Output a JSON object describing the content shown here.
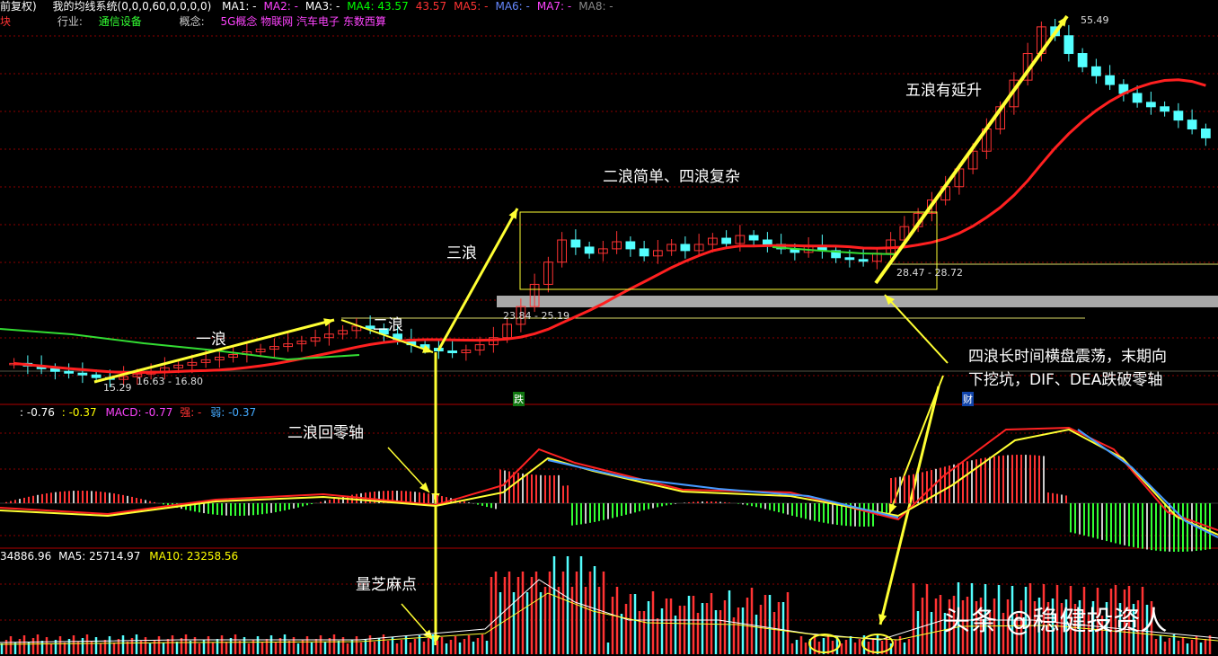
{
  "header": {
    "adjust_label": "前复权)",
    "system_label": "我的均线系统(0,0,0,60,0,0,0,0)",
    "ma_items": [
      {
        "label": "MA1:",
        "value": "-",
        "color": "#ffffff"
      },
      {
        "label": "MA2:",
        "value": "-",
        "color": "#ff44ff"
      },
      {
        "label": "MA3:",
        "value": "-",
        "color": "#ffffff"
      },
      {
        "label": "MA4:",
        "value": "43.57",
        "color": "#00ff00"
      },
      {
        "label": "",
        "value": "43.57",
        "color": "#ff3333"
      },
      {
        "label": "MA5:",
        "value": "-",
        "color": "#ff3333"
      },
      {
        "label": "MA6:",
        "value": "-",
        "color": "#6688ff"
      },
      {
        "label": "MA7:",
        "value": "-",
        "color": "#ff44ff"
      },
      {
        "label": "MA8:",
        "value": "-",
        "color": "#888888"
      }
    ],
    "block_label": "块",
    "industry_label": "行业:",
    "industry_value": "通信设备",
    "concept_label": "概念:",
    "concept_value": "5G概念 物联网 汽车电子 东数西算"
  },
  "macd_header": {
    "dif": ": -0.76",
    "dea": ": -0.37",
    "macd": "MACD: -0.77",
    "strong": "强: -",
    "weak": "弱: -0.37"
  },
  "vol_header": {
    "vol": "34886.96",
    "ma5": "MA5: 25714.97",
    "ma10": "MA10: 23258.56"
  },
  "price_labels": {
    "low": "15.29",
    "range1": "16.63 - 16.80",
    "range2": "23.84 - 25.19",
    "range3": "28.47 - 28.72",
    "high": "55.49"
  },
  "markers": {
    "die": "跌",
    "cai": "财"
  },
  "annotations": {
    "wave1": "一浪",
    "wave2": "二浪",
    "wave3": "三浪",
    "wave24": "二浪简单、四浪复杂",
    "wave5": "五浪有延升",
    "wave4_desc_line1": "四浪长时间横盘震荡，末期向",
    "wave4_desc_line2": "下挖坑，DIF、DEA跌破零轴",
    "wave2_zero": "二浪回零轴",
    "vol_dots": "量芝麻点"
  },
  "watermark": "头条 @稳健投资人",
  "colors": {
    "up": "#ff3333",
    "down": "#54ffff",
    "ma60": "#ff2020",
    "ma_green": "#33dd33",
    "annotation": "#ffff33",
    "grid": "#8b0000"
  },
  "chart_data": [
    {
      "type": "candlestick",
      "panel": "price",
      "series": [
        {
          "name": "MA4",
          "description": "60-day moving average"
        }
      ],
      "key_points": [
        {
          "label": "15.29",
          "kind": "low"
        },
        {
          "label": "16.63 - 16.80",
          "kind": "range"
        },
        {
          "label": "23.84 - 25.19",
          "kind": "range"
        },
        {
          "label": "28.47 - 28.72",
          "kind": "range"
        },
        {
          "label": "55.49",
          "kind": "high"
        }
      ],
      "approx_closes": [
        17.1,
        16.8,
        16.5,
        16.2,
        16.0,
        15.8,
        15.5,
        15.3,
        15.6,
        15.9,
        16.2,
        16.6,
        16.9,
        17.2,
        17.5,
        17.8,
        18.1,
        18.4,
        18.7,
        19.0,
        19.3,
        19.6,
        20.0,
        20.4,
        20.8,
        21.3,
        21.0,
        20.4,
        19.8,
        19.2,
        18.8,
        18.5,
        18.3,
        18.6,
        19.2,
        20.0,
        21.5,
        23.5,
        26.0,
        28.5,
        31.0,
        30.2,
        29.5,
        30.0,
        30.8,
        30.0,
        29.2,
        29.8,
        30.5,
        29.8,
        30.5,
        31.2,
        30.6,
        31.5,
        31.0,
        30.5,
        30.0,
        29.6,
        30.4,
        29.8,
        29.0,
        28.8,
        28.6,
        29.5,
        31.0,
        32.5,
        34.0,
        35.5,
        37.0,
        39.0,
        41.0,
        43.5,
        46.0,
        49.0,
        52.0,
        55.0,
        54.0,
        52.0,
        50.5,
        49.5,
        48.5,
        47.5,
        46.5,
        46.0,
        45.5,
        44.5,
        43.5,
        42.5
      ]
    },
    {
      "type": "bar",
      "panel": "macd",
      "series": [
        {
          "name": "DIF",
          "value": -0.76
        },
        {
          "name": "DEA",
          "value": -0.37
        },
        {
          "name": "MACD",
          "value": -0.77
        }
      ]
    },
    {
      "type": "bar",
      "panel": "volume",
      "series": [
        {
          "name": "VOL",
          "value": 34886.96
        },
        {
          "name": "MA5",
          "value": 25714.97
        },
        {
          "name": "MA10",
          "value": 23258.56
        }
      ]
    }
  ]
}
